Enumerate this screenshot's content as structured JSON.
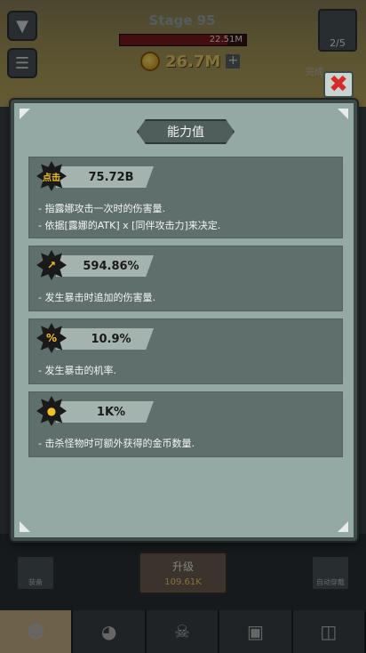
{
  "hud": {
    "stage": "Stage 95",
    "boss_hp": "22.51M",
    "boss_hp_fraction": 0.85,
    "gold": "26.7M",
    "collection_count": "2/5",
    "background_hint": "完成"
  },
  "modal": {
    "title": "能力值",
    "stats": [
      {
        "icon": "click-burst-icon",
        "icon_label": "点击",
        "value": "75.72B",
        "lines": [
          "- 指露娜攻击一次时的伤害量.",
          "- 依据[露娜的ATK] x [同伴攻击力]来决定."
        ]
      },
      {
        "icon": "crit-damage-icon",
        "value": "594.86%",
        "lines": [
          "- 发生暴击时追加的伤害量."
        ]
      },
      {
        "icon": "crit-chance-icon",
        "value": "10.9%",
        "lines": [
          "- 发生暴击的机率."
        ]
      },
      {
        "icon": "gold-bonus-icon",
        "value": "1K%",
        "lines": [
          "- 击杀怪物时可额外获得的金币数量."
        ]
      }
    ]
  },
  "bottom": {
    "left_button_label": "装备",
    "upgrade_label": "升级",
    "upgrade_cost": "109.61K",
    "right_button_label": "自动穿戴"
  },
  "colors": {
    "panel": "#94a9a3",
    "card": "#5f706c",
    "close": "#d82a2a"
  }
}
